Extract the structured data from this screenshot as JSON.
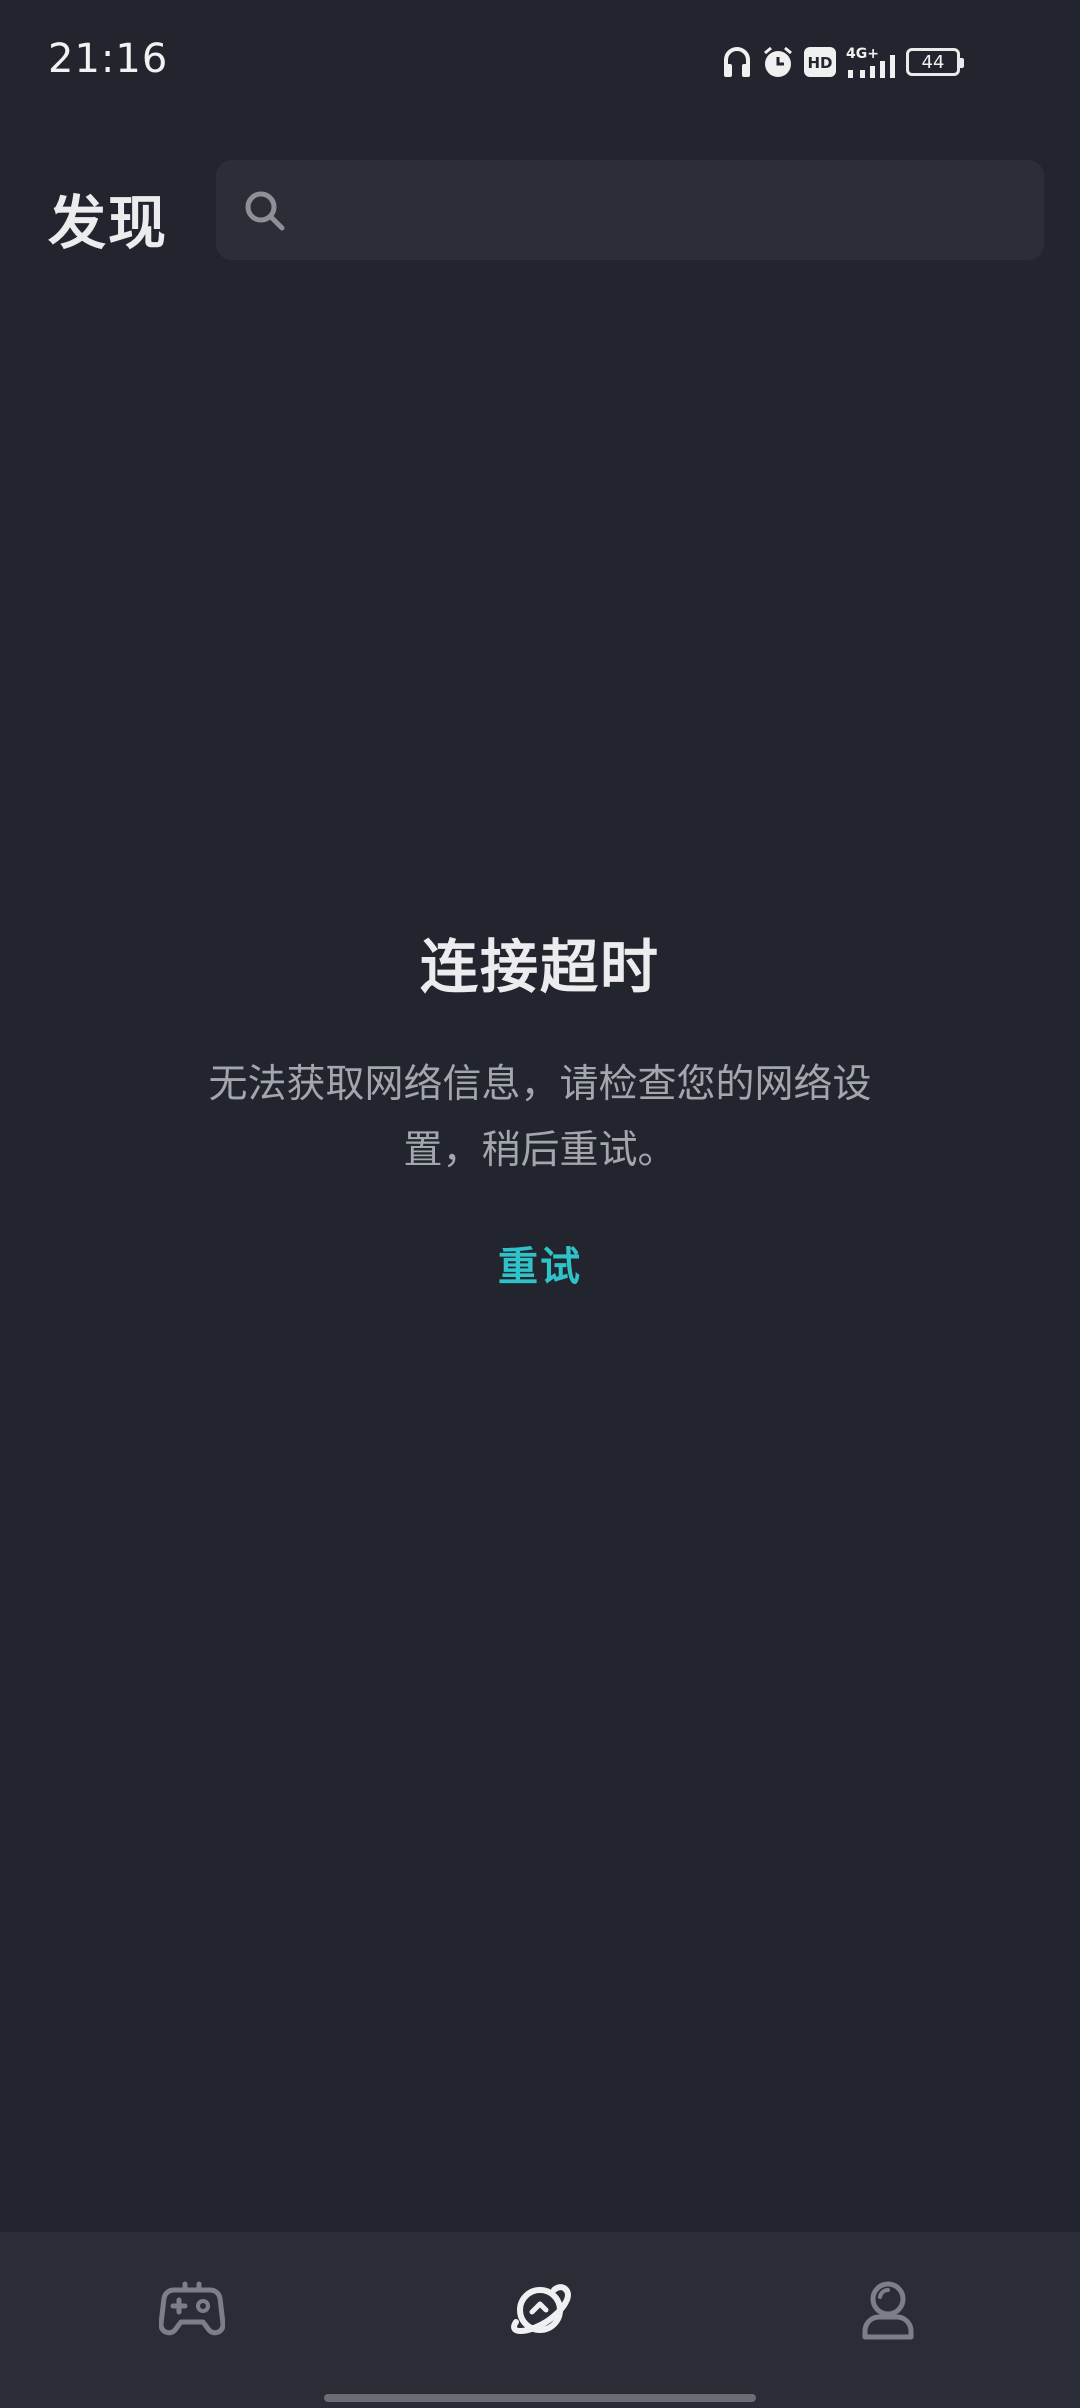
{
  "status_bar": {
    "time": "21:16",
    "network_label": "4G+",
    "hd_label": "HD",
    "battery_level": "44",
    "icons": [
      "headphones-icon",
      "alarm-icon",
      "hd-icon",
      "signal-icon",
      "battery-icon"
    ]
  },
  "header": {
    "title": "发现",
    "search_placeholder": ""
  },
  "error": {
    "title": "连接超时",
    "message": "无法获取网络信息，请检查您的网络设置，稍后重试。",
    "retry_label": "重试"
  },
  "bottom_nav": {
    "items": [
      {
        "icon": "gamepad-icon",
        "active": false
      },
      {
        "icon": "planet-icon",
        "active": true
      },
      {
        "icon": "profile-icon",
        "active": false
      }
    ]
  },
  "colors": {
    "background": "#22252e",
    "accent": "#2fc3c9",
    "nav_background": "#2a2d36",
    "search_background": "#2b2e37"
  }
}
